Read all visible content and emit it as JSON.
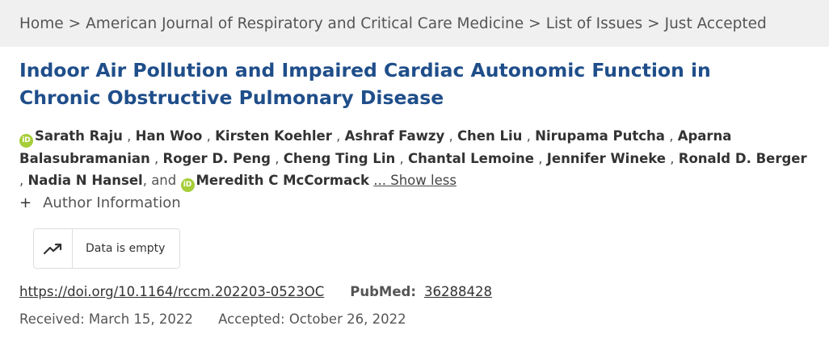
{
  "breadcrumb": {
    "items": [
      "Home",
      "American Journal of Respiratory and Critical Care Medicine",
      "List of Issues",
      "Just Accepted"
    ],
    "separator": ">"
  },
  "article": {
    "title": "Indoor Air Pollution and Impaired Cardiac Autonomic Function in Chronic Obstructive Pulmonary Disease",
    "authors": [
      "Sarath Raju",
      "Han Woo",
      "Kirsten Koehler",
      "Ashraf Fawzy",
      "Chen Liu",
      "Nirupama Putcha",
      "Aparna Balasubramanian",
      "Roger D. Peng",
      "Cheng Ting Lin",
      "Chantal Lemoine",
      "Jennifer Wineke",
      "Ronald D. Berger",
      "Nadia N Hansel",
      "Meredith C McCormack"
    ],
    "author_separator": ",",
    "and_text": ", and",
    "orcid_badge": "iD",
    "show_less_label": "... Show less",
    "author_info_toggle": "+",
    "author_info_label": "Author Information",
    "metrics": {
      "icon": "trending-up-icon",
      "text": "Data is empty"
    },
    "doi": "https://doi.org/10.1164/rccm.202203-0523OC",
    "pubmed_label": "PubMed:",
    "pubmed_id": "36288428",
    "received": "Received: March 15, 2022",
    "accepted": "Accepted: October 26, 2022"
  },
  "colors": {
    "title": "#1f4e8a",
    "orcid": "#a6ce39",
    "breadcrumb_bg": "#f0f0f0"
  }
}
